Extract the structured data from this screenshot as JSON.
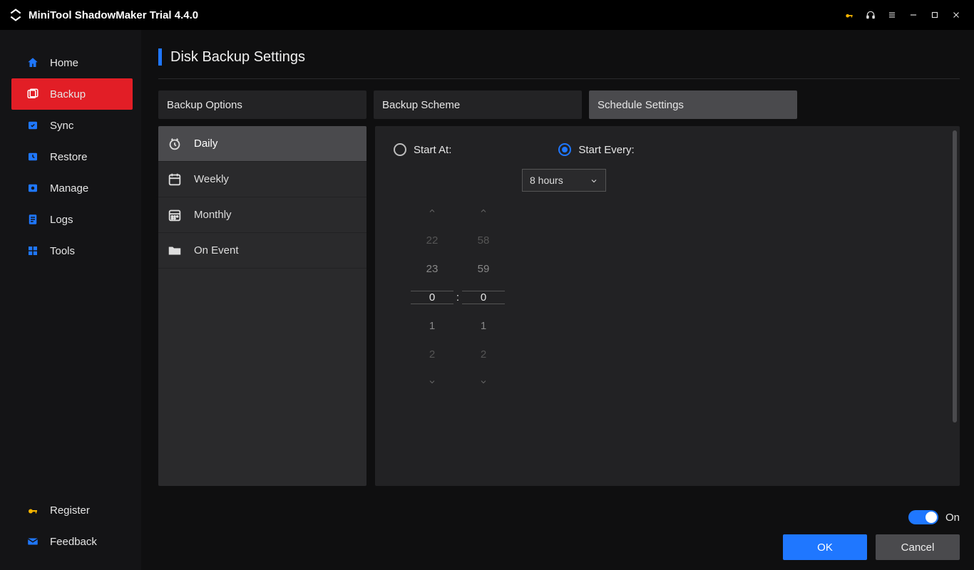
{
  "app_title": "MiniTool ShadowMaker Trial 4.4.0",
  "sidebar": {
    "items": [
      {
        "label": "Home"
      },
      {
        "label": "Backup"
      },
      {
        "label": "Sync"
      },
      {
        "label": "Restore"
      },
      {
        "label": "Manage"
      },
      {
        "label": "Logs"
      },
      {
        "label": "Tools"
      }
    ],
    "active_index": 1,
    "bottom": [
      {
        "label": "Register"
      },
      {
        "label": "Feedback"
      }
    ]
  },
  "page": {
    "title": "Disk Backup Settings",
    "tabs": [
      "Backup Options",
      "Backup Scheme",
      "Schedule Settings"
    ],
    "active_tab": 2,
    "schedule_tabs": [
      "Daily",
      "Weekly",
      "Monthly",
      "On Event"
    ],
    "schedule_active": 0,
    "radio": {
      "start_at": "Start At:",
      "start_every": "Start Every:",
      "selected": "start_every"
    },
    "interval_value": "8 hours",
    "time_wheel": {
      "hours": [
        "22",
        "23",
        "0",
        "1",
        "2"
      ],
      "minutes": [
        "58",
        "59",
        "0",
        "1",
        "2"
      ]
    },
    "toggle_label": "On",
    "ok": "OK",
    "cancel": "Cancel"
  }
}
